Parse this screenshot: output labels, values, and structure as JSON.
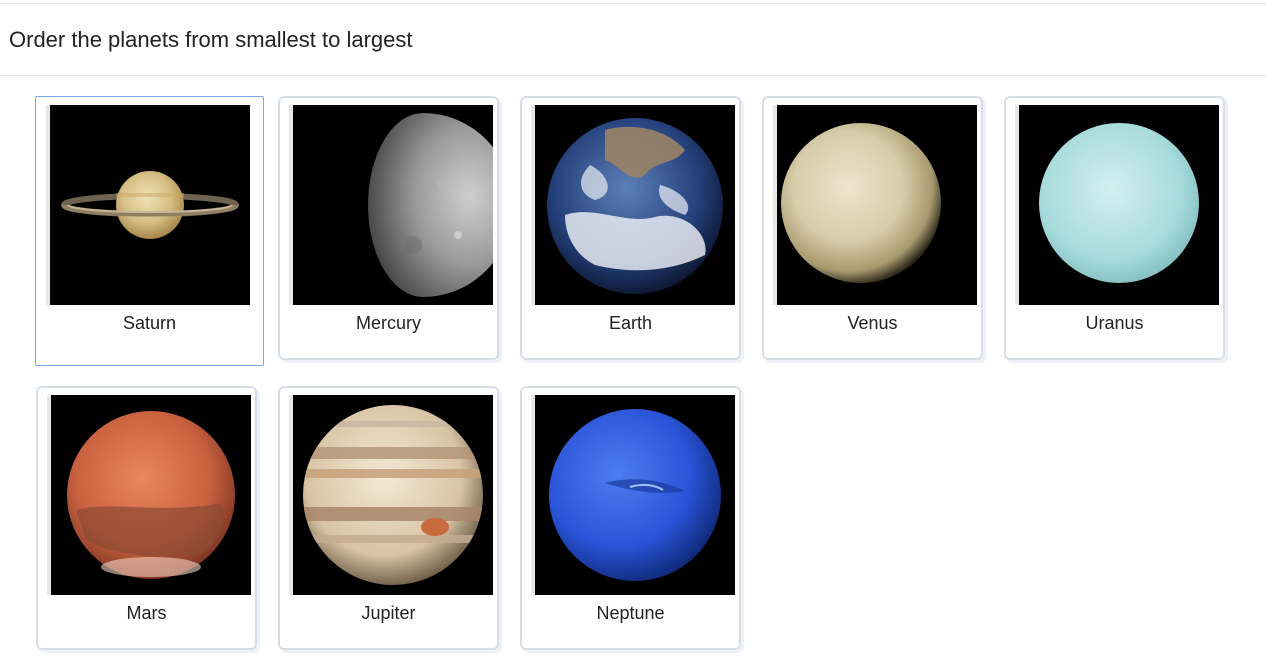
{
  "prompt": "Order the planets from smallest to largest",
  "cards": [
    {
      "label": "Saturn",
      "icon": "saturn-image"
    },
    {
      "label": "Mercury",
      "icon": "mercury-image"
    },
    {
      "label": "Earth",
      "icon": "earth-image"
    },
    {
      "label": "Venus",
      "icon": "venus-image"
    },
    {
      "label": "Uranus",
      "icon": "uranus-image"
    },
    {
      "label": "Mars",
      "icon": "mars-image"
    },
    {
      "label": "Jupiter",
      "icon": "jupiter-image"
    },
    {
      "label": "Neptune",
      "icon": "neptune-image"
    }
  ],
  "colors": {
    "selected_border": "#7aa7ec",
    "card_border": "#d8dee6"
  }
}
